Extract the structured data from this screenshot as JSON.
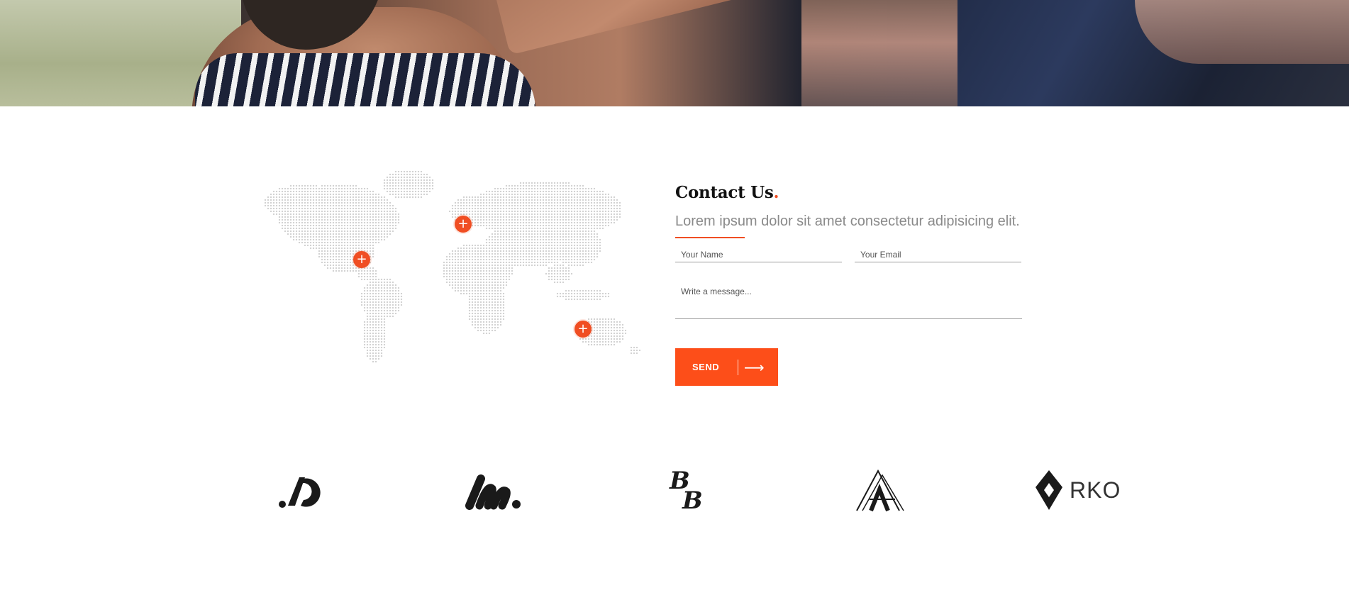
{
  "hero": {
    "image": "people-stretching-photo"
  },
  "map": {
    "pins": [
      {
        "name": "north-america-pin",
        "symbol": "+"
      },
      {
        "name": "europe-pin",
        "symbol": "+"
      },
      {
        "name": "australia-pin",
        "symbol": "+"
      }
    ]
  },
  "contact": {
    "title": "Contact Us",
    "title_dot": ".",
    "lead": "Lorem ipsum dolor sit amet consectetur adipisicing elit.",
    "name_placeholder": "Your Name",
    "email_placeholder": "Your Email",
    "message_placeholder": "Write a message...",
    "send_label": "SEND",
    "send_arrow": "⟶"
  },
  "logos": [
    {
      "name": "ad-logo"
    },
    {
      "name": "m-logo"
    },
    {
      "name": "bb-logo"
    },
    {
      "name": "a-logo"
    },
    {
      "name": "rko-logo",
      "text": "RKO"
    }
  ],
  "colors": {
    "accent": "#f04e23",
    "button": "#fd4e19",
    "text": "#111111",
    "muted": "#8a8a8a",
    "map_dot": "#cfcfcf"
  }
}
